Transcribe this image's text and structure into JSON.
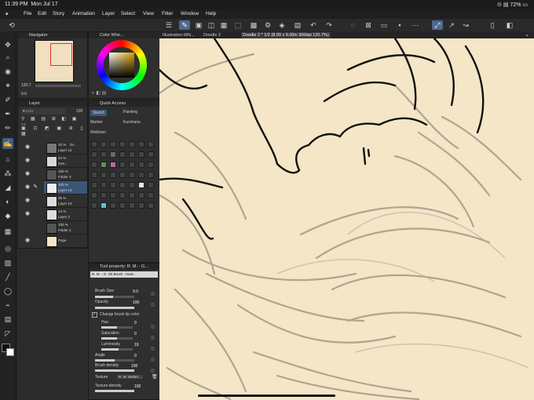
{
  "status": {
    "time": "11:39 PM",
    "date": "Mon Jul 17",
    "battery": "72%"
  },
  "menu": [
    "File",
    "Edit",
    "Story",
    "Animation",
    "Layer",
    "Select",
    "Filter",
    "Window",
    "Help"
  ],
  "navigator": {
    "title": "Navigator",
    "zoom": "120.7",
    "angle": "0.0"
  },
  "color_wheel": {
    "title": "Color Whe..."
  },
  "layer_panel": {
    "title": "Layer",
    "opacity": "100",
    "rows": [
      {
        "pct": "32 %",
        "mode": "Gr...",
        "name": "Layer 12"
      },
      {
        "pct": "24 %",
        "mode": "Layer",
        "name": "Gen..."
      },
      {
        "pct": "100 %",
        "mode": "",
        "name": "Folder 3"
      },
      {
        "pct": "100 %",
        "mode": "",
        "name": "Layer 14"
      },
      {
        "pct": "35 %",
        "mode": "",
        "name": "Layer 13"
      },
      {
        "pct": "14 %",
        "mode": "",
        "name": "Layer 2"
      },
      {
        "pct": "100 %",
        "mode": "",
        "name": "Folder 4"
      },
      {
        "pct": "",
        "mode": "",
        "name": "Pape"
      }
    ]
  },
  "quick_access": {
    "title": "Quick Access",
    "tabs": [
      "Sketch",
      "Painting",
      "Marker",
      "Kurohana",
      "Webtoon"
    ]
  },
  "tool_property": {
    "title": "Tool property: R. M. - G...",
    "brush_name": "R. M. - G. Oil Brush - Neat",
    "props": [
      {
        "label": "Brush Size",
        "value": "9.0"
      },
      {
        "label": "Opacity",
        "value": "100"
      },
      {
        "label": "Change brush tip color",
        "value": ""
      },
      {
        "label": "Hue",
        "value": "0"
      },
      {
        "label": "Saturation",
        "value": "0"
      },
      {
        "label": "Luminosity",
        "value": "19"
      },
      {
        "label": "Angle",
        "value": "0"
      },
      {
        "label": "Brush density",
        "value": "100"
      },
      {
        "label": "Texture",
        "value": "R. M. Wetter..."
      },
      {
        "label": "Texture density",
        "value": "100"
      }
    ],
    "progress": {
      "brush_size": 0.45,
      "opacity": 1.0,
      "hue": 0.5,
      "saturation": 0.5,
      "luminosity": 0.55,
      "angle": 0.5,
      "density": 1.0,
      "texture_density": 1.0
    }
  },
  "doc_tabs": [
    {
      "label": "Illustration-Whi...",
      "active": false
    },
    {
      "label": "Doodle 2",
      "active": false
    },
    {
      "label": "Doodle 2 * 1/2 (8.00 x 9.00in 300dpi 120.7%)",
      "active": true
    }
  ],
  "colors": {
    "canvas_paper": "#f4e6c6",
    "ui_bg": "#2b2b2b",
    "accent": "#3b5676"
  }
}
